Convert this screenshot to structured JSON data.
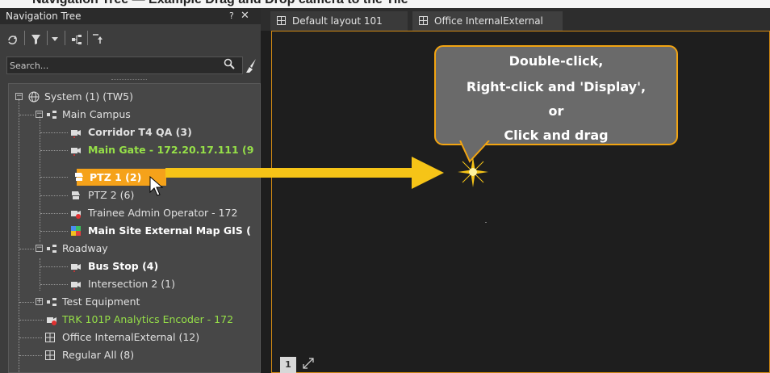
{
  "header_text": "Navigation Tree — Example Drag and Drop camera to the Tile",
  "nav": {
    "title": "Navigation Tree",
    "pin_glyph": "? ",
    "close_glyph": "✕",
    "search_placeholder": "Search...",
    "toolbar_icons": [
      "refresh-icon",
      "filter-icon",
      "dropdown-arrow-icon",
      "hierarchy-icon",
      "collapse-all-icon"
    ]
  },
  "tree": [
    {
      "label": "System (1) (TW5)",
      "icon": "globe-icon"
    },
    {
      "label": "Main Campus",
      "icon": "folder-group-icon"
    },
    {
      "label": "Corridor T4 QA (3)",
      "icon": "camera-icon"
    },
    {
      "label": "Main Gate - 172.20.17.111 (9",
      "icon": "camera-icon"
    },
    {
      "label": "PTZ 1 (2)",
      "icon": "ptz-camera-icon",
      "selected": true
    },
    {
      "label": "PTZ 2 (6)",
      "icon": "ptz-camera-icon"
    },
    {
      "label": "Trainee Admin Operator - 172",
      "icon": "camera-alert-icon"
    },
    {
      "label": "Main Site External Map GIS (",
      "icon": "map-icon"
    },
    {
      "label": "Roadway",
      "icon": "folder-group-icon"
    },
    {
      "label": "Bus Stop (4)",
      "icon": "camera-icon"
    },
    {
      "label": "Intersection 2 (1)",
      "icon": "camera-icon"
    },
    {
      "label": "Test Equipment",
      "icon": "folder-group-icon"
    },
    {
      "label": "TRK 101P Analytics Encoder - 172",
      "icon": "camera-alert-icon"
    },
    {
      "label": "Office InternalExternal (12)",
      "icon": "layout-icon"
    },
    {
      "label": "Regular All (8)",
      "icon": "layout-icon"
    }
  ],
  "tabs": [
    {
      "label": "Default layout 101",
      "icon": "layout-icon"
    },
    {
      "label": "Office InternalExternal",
      "icon": "layout-icon",
      "active": true
    }
  ],
  "callout": {
    "line1": "Double-click,",
    "line2": "Right-click and 'Display',",
    "line3": "or",
    "line4": "Click and drag"
  },
  "page_number": "1",
  "colors": {
    "accent": "#f5a21a",
    "callout_border": "#f2a411",
    "arrow": "#f6c417",
    "green_text": "#96e048",
    "panel_bg": "#3d3d3d",
    "viewer_bg": "#1e1e1e"
  }
}
